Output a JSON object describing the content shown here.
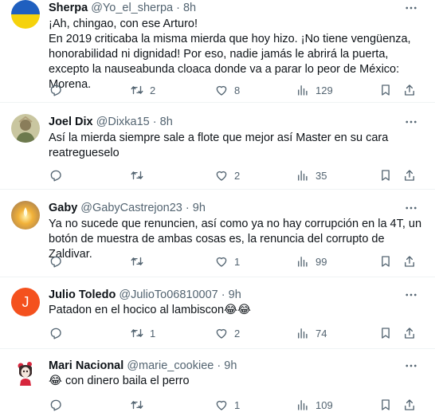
{
  "tweets": [
    {
      "name": "Sherpa",
      "handle": "@Yo_el_sherpa",
      "dot": "·",
      "time": "8h",
      "text": "¡Ah, chingao, con ese Arturo!\nEn 2019 criticaba la misma mierda que hoy hizo. ¡No tiene vengüenza, honorabilidad ni dignidad! Por eso, nadie jamás le abrirá la puerta, excepto la nauseabunda cloaca donde va a parar lo peor de México: Morena.",
      "replies": "",
      "retweets": "2",
      "likes": "8",
      "views": "129",
      "avatar": "flag-ukraine"
    },
    {
      "name": "Joel Dix",
      "handle": "@Dixka15",
      "dot": "·",
      "time": "8h",
      "text": "Así la mierda siempre sale a flote  que mejor así Master en su cara reatregueselo",
      "replies": "",
      "retweets": "",
      "likes": "2",
      "views": "35",
      "avatar": "photo"
    },
    {
      "name": "Gaby",
      "handle": "@GabyCastrejon23",
      "dot": "·",
      "time": "9h",
      "text": "Ya no sucede que renuncien, así como ya no hay corrupción en la 4T, un botón de muestra de ambas cosas es, la renuncia del corrupto de Zaldivar.",
      "replies": "",
      "retweets": "",
      "likes": "1",
      "views": "99",
      "avatar": "candle-photo"
    },
    {
      "name": "Julio Toledo",
      "handle": "@JulioTo06810007",
      "dot": "·",
      "time": "9h",
      "text": "Patadon en el hocico al lambiscon😂😂",
      "replies": "",
      "retweets": "1",
      "likes": "2",
      "views": "74",
      "avatar": "J",
      "avatar_color": "#f4511e"
    },
    {
      "name": "Mari Nacional",
      "handle": "@marie_cookiee",
      "dot": "·",
      "time": "9h",
      "text": "😂 con dinero baila el perro",
      "replies": "",
      "retweets": "",
      "likes": "1",
      "views": "109",
      "avatar": "catrina-illustration"
    }
  ],
  "colors": {
    "text": "#0f1419",
    "secondary": "#536471",
    "divider": "#eff3f4"
  }
}
